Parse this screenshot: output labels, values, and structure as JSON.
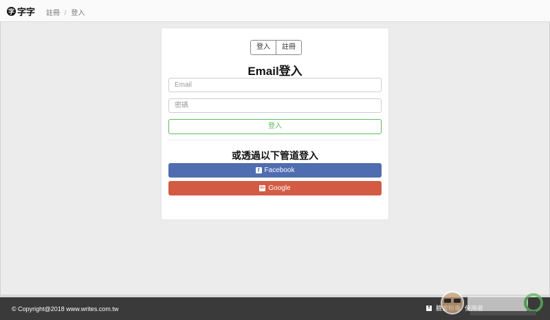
{
  "header": {
    "logo_mark": "字",
    "logo_text": "字字",
    "breadcrumb": [
      "註冊",
      "登入"
    ],
    "breadcrumb_sep": "/"
  },
  "auth": {
    "tabs": [
      "登入",
      "註冊"
    ],
    "title": "Email登入",
    "email_placeholder": "Email",
    "password_placeholder": "密碼",
    "submit_label": "登入",
    "social_title": "或透過以下管道登入",
    "facebook_label": "Facebook",
    "facebook_icon": "f",
    "google_label": "Google",
    "google_icon": "G+"
  },
  "footer": {
    "copyright": "© Copyright@2018 www.writes.com.tw",
    "links": [
      "f",
      "臉書粉專",
      "使用者"
    ]
  },
  "colors": {
    "facebook": "#4f6db0",
    "google": "#d35a43",
    "success": "#5cb85c",
    "footer_bg": "#3a3a3a"
  }
}
